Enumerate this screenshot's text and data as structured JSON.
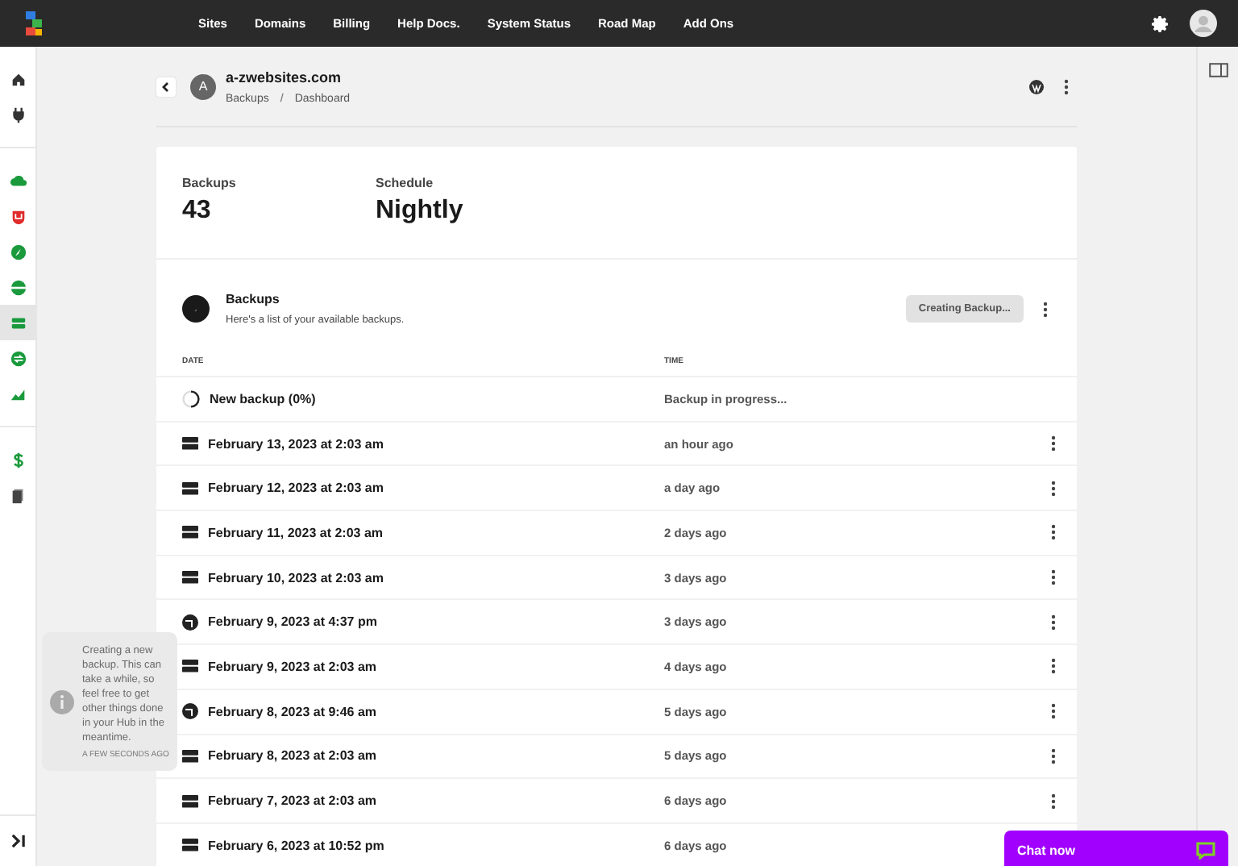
{
  "top_nav": {
    "links": [
      "Sites",
      "Domains",
      "Billing",
      "Help Docs.",
      "System Status",
      "Road Map",
      "Add Ons"
    ]
  },
  "sidebar": {
    "items": [
      {
        "kind": "home",
        "selected": false
      },
      {
        "kind": "plug",
        "selected": false
      },
      {
        "kind": "divider"
      },
      {
        "kind": "cloud",
        "selected": false
      },
      {
        "kind": "shield",
        "selected": false
      },
      {
        "kind": "compass",
        "selected": false
      },
      {
        "kind": "globe",
        "selected": false
      },
      {
        "kind": "servers",
        "selected": true
      },
      {
        "kind": "swap",
        "selected": false
      },
      {
        "kind": "chart",
        "selected": false
      },
      {
        "kind": "divider"
      },
      {
        "kind": "dollar",
        "selected": false
      },
      {
        "kind": "files",
        "selected": false
      }
    ]
  },
  "site": {
    "avatar": "A",
    "name": "a-zwebsites.com",
    "breadcrumb": [
      "Backups",
      "Dashboard"
    ],
    "separator": "/"
  },
  "stats": [
    {
      "label": "Backups",
      "value": "43"
    },
    {
      "label": "Schedule",
      "value": "Nightly"
    }
  ],
  "backups": {
    "title": "Backups",
    "subtitle": "Here's a list of your available backups.",
    "button": "Creating Backup...",
    "columns": [
      "DATE",
      "TIME"
    ],
    "rows": [
      {
        "kind": "progress",
        "date": "New backup (0%)",
        "time": "Backup in progress..."
      },
      {
        "kind": "server",
        "date": "February 13, 2023 at 2:03 am",
        "time": "an hour ago"
      },
      {
        "kind": "server",
        "date": "February 12, 2023 at 2:03 am",
        "time": "a day ago"
      },
      {
        "kind": "server",
        "date": "February 11, 2023 at 2:03 am",
        "time": "2 days ago"
      },
      {
        "kind": "server",
        "date": "February 10, 2023 at 2:03 am",
        "time": "3 days ago"
      },
      {
        "kind": "site",
        "date": "February 9, 2023 at 4:37 pm",
        "time": "3 days ago"
      },
      {
        "kind": "server",
        "date": "February 9, 2023 at 2:03 am",
        "time": "4 days ago"
      },
      {
        "kind": "site",
        "date": "February 8, 2023 at 9:46 am",
        "time": "5 days ago"
      },
      {
        "kind": "server",
        "date": "February 8, 2023 at 2:03 am",
        "time": "5 days ago"
      },
      {
        "kind": "server",
        "date": "February 7, 2023 at 2:03 am",
        "time": "6 days ago"
      },
      {
        "kind": "server",
        "date": "February 6, 2023 at 10:52 pm",
        "time": "6 days ago"
      }
    ]
  },
  "toast": {
    "message": "Creating a new backup. This can take a while, so feel free to get other things done in your Hub in the meantime.",
    "time": "A FEW SECONDS AGO"
  },
  "chat": {
    "label": "Chat now"
  }
}
